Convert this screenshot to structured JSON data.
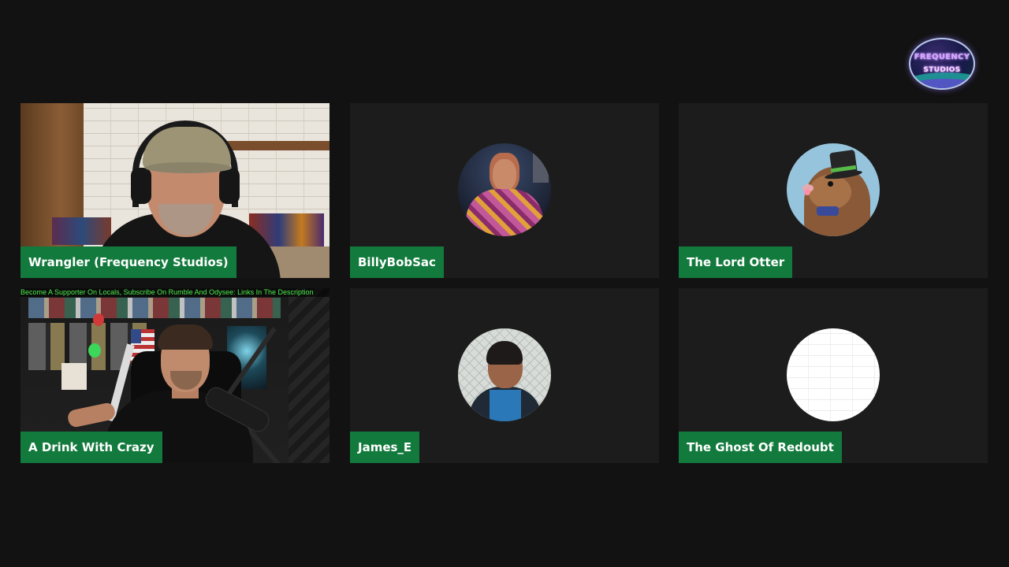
{
  "app": {
    "logo_text_line1": "FREQUENCY",
    "logo_text_line2": "STUDIOS"
  },
  "participants": [
    {
      "name": "Wrangler (Frequency Studios)",
      "video": true
    },
    {
      "name": "BillyBobSac",
      "video": false
    },
    {
      "name": "The Lord Otter",
      "video": false
    },
    {
      "name": "A Drink With Crazy",
      "video": true,
      "overlay_text": "Become A Supporter On Locals, Subscribe On Rumble And Odysee: Links In The Description"
    },
    {
      "name": "James_E",
      "video": false
    },
    {
      "name": "The Ghost Of Redoubt",
      "video": false
    }
  ],
  "colors": {
    "background": "#121212",
    "tile_background": "#1c1c1c",
    "name_tag": "#137a3d",
    "ticker_text": "#4cf04c"
  }
}
